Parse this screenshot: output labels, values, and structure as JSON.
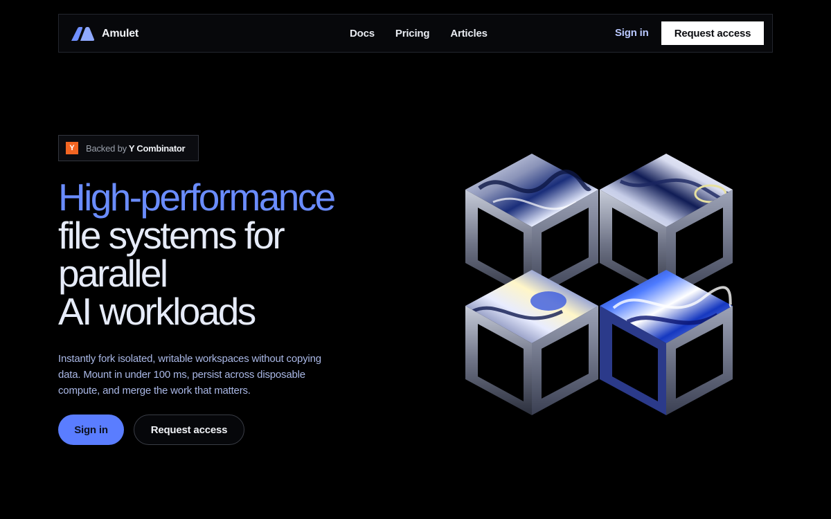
{
  "brand": {
    "name": "Amulet",
    "icon": "amulet-logo-icon",
    "logo_color": "#6f8fff"
  },
  "nav": {
    "links": [
      {
        "label": "Docs"
      },
      {
        "label": "Pricing"
      },
      {
        "label": "Articles"
      }
    ],
    "sign_in": "Sign in",
    "cta": "Request access"
  },
  "badge": {
    "icon_letter": "Y",
    "prefix": "Backed by",
    "highlight": "Y Combinator",
    "icon_color": "#f26522"
  },
  "hero": {
    "headline_accent": "High-performance",
    "headline_lines": [
      "file systems for",
      "parallel",
      "AI workloads"
    ],
    "subtitle": "Instantly fork isolated, writable workspaces without copying data. Mount in under 100 ms, persist across disposable compute, and merge the work that matters.",
    "primary_button": "Sign in",
    "secondary_button": "Request access",
    "art_icon": "chrome-cubes-illustration-icon"
  },
  "colors": {
    "accent": "#6a8cff",
    "primary_button": "#5a7dff",
    "background": "#000000"
  }
}
